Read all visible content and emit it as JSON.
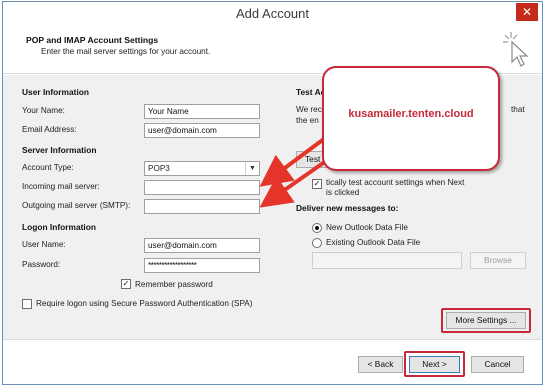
{
  "window": {
    "title": "Add Account",
    "close_glyph": "✕"
  },
  "header": {
    "title": "POP and IMAP Account Settings",
    "subtitle": "Enter the mail server settings for your account."
  },
  "user_info": {
    "section_title": "User Information",
    "name_label": "Your Name:",
    "name_value": "Your Name",
    "email_label": "Email Address:",
    "email_value": "user@domain.com"
  },
  "server_info": {
    "section_title": "Server Information",
    "account_type_label": "Account Type:",
    "account_type_value": "POP3",
    "incoming_label": "Incoming mail server:",
    "incoming_value": "",
    "outgoing_label": "Outgoing mail server (SMTP):",
    "outgoing_value": ""
  },
  "logon_info": {
    "section_title": "Logon Information",
    "username_label": "User Name:",
    "username_value": "user@domain.com",
    "password_label": "Password:",
    "password_value": "******************",
    "remember_label": "Remember password",
    "remember_checked": true,
    "spa_label": "Require logon using Secure Password Authentication (SPA)",
    "spa_checked": false
  },
  "test_settings": {
    "section_title_visible": "Test Ac",
    "desc_line1_visible": "We rec",
    "desc_line1_end": "that",
    "desc_line2_visible": "the en",
    "test_button_visible": "Test Ac",
    "auto_test_label_line1": "tically test account settings when Next",
    "auto_test_label_line2": "is clicked",
    "auto_test_checked": true
  },
  "deliver": {
    "title": "Deliver new messages to:",
    "option_new": "New Outlook Data File",
    "option_existing": "Existing Outlook Data File",
    "browse_label": "Browse",
    "selected": "new"
  },
  "more_settings_label": "More Settings ...",
  "footer": {
    "back_label": "< Back",
    "next_label": "Next >",
    "cancel_label": "Cancel"
  },
  "callout": {
    "text": "kusamailer.tenten.cloud"
  },
  "colors": {
    "highlight_red": "#c8283a",
    "dialog_bg": "#f0f0f0",
    "close_red": "#c42b1c"
  },
  "icons": {
    "cursor": "click-cursor-icon",
    "dropdown": "chevron-down-icon",
    "close": "close-icon"
  }
}
